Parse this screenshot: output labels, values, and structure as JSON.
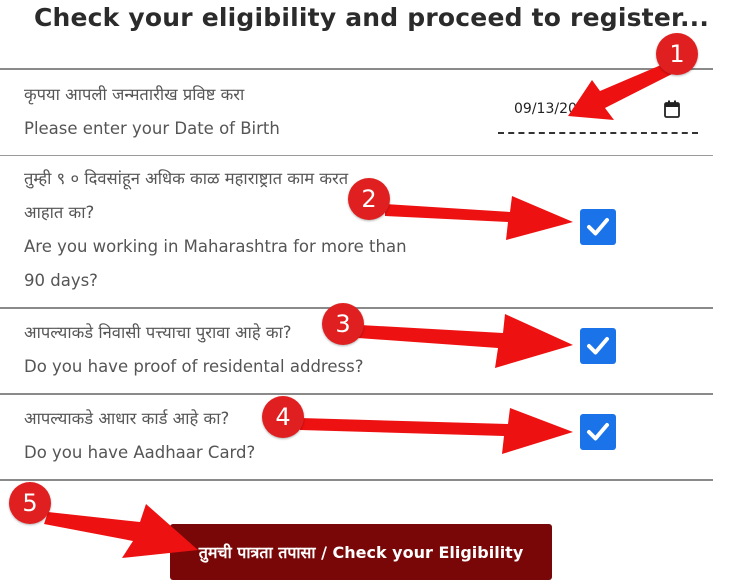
{
  "page": {
    "title": "Check your eligibility and proceed to register..."
  },
  "dob": {
    "label_mr": "कृपया आपली जन्मतारीख प्रविष्ट करा",
    "label_en": "Please enter your Date of Birth",
    "value": "09/13/2020",
    "icon": "calendar-icon"
  },
  "questions": [
    {
      "lines": [
        "तुम्ही ९ ० दिवसांहून अधिक काळ महाराष्ट्रात काम करत",
        "आहात का?",
        "Are you working in Maharashtra for more than",
        "90 days?"
      ],
      "checked": true
    },
    {
      "lines": [
        "आपल्याकडे निवासी पत्त्याचा पुरावा आहे का?",
        "Do you have proof of residental address?"
      ],
      "checked": true
    },
    {
      "lines": [
        "आपल्याकडे आधार कार्ड आहे का?",
        "Do you have Aadhaar Card?"
      ],
      "checked": true
    }
  ],
  "submit": {
    "label": "तुमची पात्रता तपासा / Check your Eligibility"
  },
  "annotations": {
    "badges": [
      "1",
      "2",
      "3",
      "4",
      "5"
    ],
    "color": "#e02020"
  },
  "colors": {
    "checkbox": "#1a73e8",
    "button": "#7a0707",
    "rule": "#8a8a8a"
  }
}
